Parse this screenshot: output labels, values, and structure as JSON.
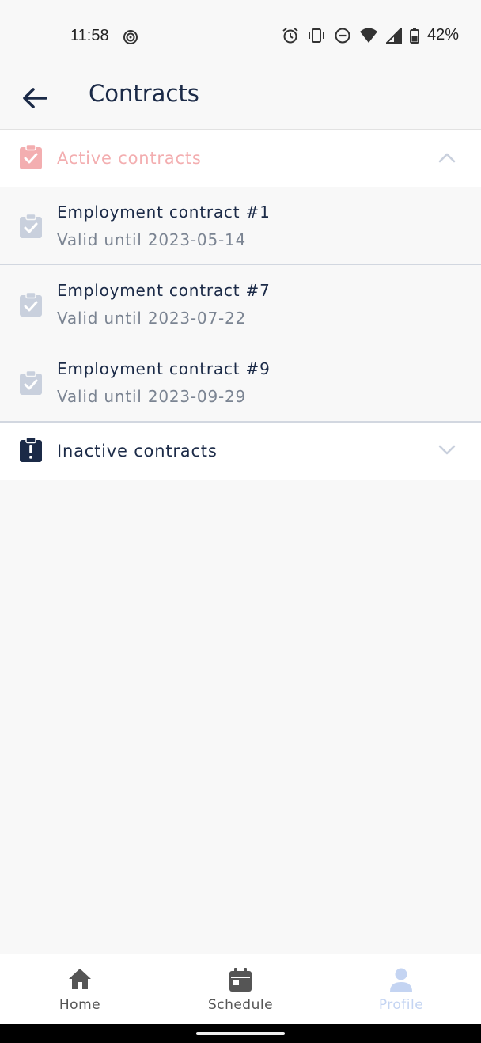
{
  "status_bar": {
    "time": "11:58",
    "battery": "42%",
    "icons": [
      "radar-icon",
      "alarm-icon",
      "vibrate-icon",
      "do-not-disturb-icon",
      "wifi-icon",
      "signal-icon",
      "battery-icon"
    ]
  },
  "app_bar": {
    "title": "Contracts",
    "back_icon": "arrow-left-icon"
  },
  "sections": {
    "active": {
      "label": "Active contracts",
      "icon": "clipboard-check-icon",
      "expanded": true,
      "color": "#f3aeb0"
    },
    "inactive": {
      "label": "Inactive contracts",
      "icon": "clipboard-alert-icon",
      "expanded": false,
      "color": "#1b2a47"
    }
  },
  "contracts": [
    {
      "title": "Employment contract #1",
      "subtitle": "Valid until 2023-05-14"
    },
    {
      "title": "Employment contract #7",
      "subtitle": "Valid until 2023-07-22"
    },
    {
      "title": "Employment contract #9",
      "subtitle": "Valid until 2023-09-29"
    }
  ],
  "bottom_nav": {
    "items": [
      {
        "label": "Home",
        "icon": "home-icon",
        "active": false
      },
      {
        "label": "Schedule",
        "icon": "calendar-icon",
        "active": false
      },
      {
        "label": "Profile",
        "icon": "person-icon",
        "active": true
      }
    ]
  },
  "colors": {
    "primary": "#1b2a47",
    "accent_pink": "#f3aeb0",
    "muted_icon": "#c9d0dd",
    "active_nav": "#c4d4f2"
  }
}
